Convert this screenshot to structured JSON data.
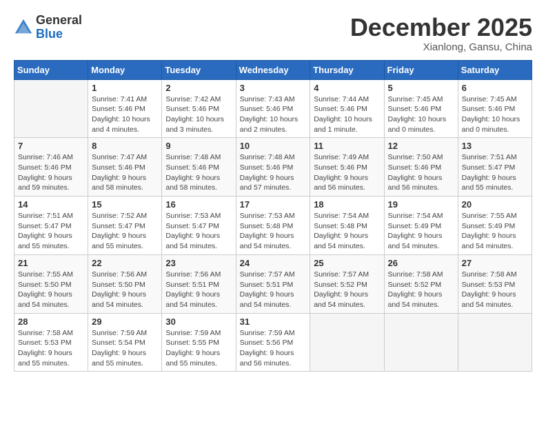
{
  "header": {
    "logo_line1": "General",
    "logo_line2": "Blue",
    "month": "December 2025",
    "location": "Xianlong, Gansu, China"
  },
  "weekdays": [
    "Sunday",
    "Monday",
    "Tuesday",
    "Wednesday",
    "Thursday",
    "Friday",
    "Saturday"
  ],
  "weeks": [
    [
      {
        "day": "",
        "info": ""
      },
      {
        "day": "1",
        "info": "Sunrise: 7:41 AM\nSunset: 5:46 PM\nDaylight: 10 hours\nand 4 minutes."
      },
      {
        "day": "2",
        "info": "Sunrise: 7:42 AM\nSunset: 5:46 PM\nDaylight: 10 hours\nand 3 minutes."
      },
      {
        "day": "3",
        "info": "Sunrise: 7:43 AM\nSunset: 5:46 PM\nDaylight: 10 hours\nand 2 minutes."
      },
      {
        "day": "4",
        "info": "Sunrise: 7:44 AM\nSunset: 5:46 PM\nDaylight: 10 hours\nand 1 minute."
      },
      {
        "day": "5",
        "info": "Sunrise: 7:45 AM\nSunset: 5:46 PM\nDaylight: 10 hours\nand 0 minutes."
      },
      {
        "day": "6",
        "info": "Sunrise: 7:45 AM\nSunset: 5:46 PM\nDaylight: 10 hours\nand 0 minutes."
      }
    ],
    [
      {
        "day": "7",
        "info": "Sunrise: 7:46 AM\nSunset: 5:46 PM\nDaylight: 9 hours\nand 59 minutes."
      },
      {
        "day": "8",
        "info": "Sunrise: 7:47 AM\nSunset: 5:46 PM\nDaylight: 9 hours\nand 58 minutes."
      },
      {
        "day": "9",
        "info": "Sunrise: 7:48 AM\nSunset: 5:46 PM\nDaylight: 9 hours\nand 58 minutes."
      },
      {
        "day": "10",
        "info": "Sunrise: 7:48 AM\nSunset: 5:46 PM\nDaylight: 9 hours\nand 57 minutes."
      },
      {
        "day": "11",
        "info": "Sunrise: 7:49 AM\nSunset: 5:46 PM\nDaylight: 9 hours\nand 56 minutes."
      },
      {
        "day": "12",
        "info": "Sunrise: 7:50 AM\nSunset: 5:46 PM\nDaylight: 9 hours\nand 56 minutes."
      },
      {
        "day": "13",
        "info": "Sunrise: 7:51 AM\nSunset: 5:47 PM\nDaylight: 9 hours\nand 55 minutes."
      }
    ],
    [
      {
        "day": "14",
        "info": "Sunrise: 7:51 AM\nSunset: 5:47 PM\nDaylight: 9 hours\nand 55 minutes."
      },
      {
        "day": "15",
        "info": "Sunrise: 7:52 AM\nSunset: 5:47 PM\nDaylight: 9 hours\nand 55 minutes."
      },
      {
        "day": "16",
        "info": "Sunrise: 7:53 AM\nSunset: 5:47 PM\nDaylight: 9 hours\nand 54 minutes."
      },
      {
        "day": "17",
        "info": "Sunrise: 7:53 AM\nSunset: 5:48 PM\nDaylight: 9 hours\nand 54 minutes."
      },
      {
        "day": "18",
        "info": "Sunrise: 7:54 AM\nSunset: 5:48 PM\nDaylight: 9 hours\nand 54 minutes."
      },
      {
        "day": "19",
        "info": "Sunrise: 7:54 AM\nSunset: 5:49 PM\nDaylight: 9 hours\nand 54 minutes."
      },
      {
        "day": "20",
        "info": "Sunrise: 7:55 AM\nSunset: 5:49 PM\nDaylight: 9 hours\nand 54 minutes."
      }
    ],
    [
      {
        "day": "21",
        "info": "Sunrise: 7:55 AM\nSunset: 5:50 PM\nDaylight: 9 hours\nand 54 minutes."
      },
      {
        "day": "22",
        "info": "Sunrise: 7:56 AM\nSunset: 5:50 PM\nDaylight: 9 hours\nand 54 minutes."
      },
      {
        "day": "23",
        "info": "Sunrise: 7:56 AM\nSunset: 5:51 PM\nDaylight: 9 hours\nand 54 minutes."
      },
      {
        "day": "24",
        "info": "Sunrise: 7:57 AM\nSunset: 5:51 PM\nDaylight: 9 hours\nand 54 minutes."
      },
      {
        "day": "25",
        "info": "Sunrise: 7:57 AM\nSunset: 5:52 PM\nDaylight: 9 hours\nand 54 minutes."
      },
      {
        "day": "26",
        "info": "Sunrise: 7:58 AM\nSunset: 5:52 PM\nDaylight: 9 hours\nand 54 minutes."
      },
      {
        "day": "27",
        "info": "Sunrise: 7:58 AM\nSunset: 5:53 PM\nDaylight: 9 hours\nand 54 minutes."
      }
    ],
    [
      {
        "day": "28",
        "info": "Sunrise: 7:58 AM\nSunset: 5:53 PM\nDaylight: 9 hours\nand 55 minutes."
      },
      {
        "day": "29",
        "info": "Sunrise: 7:59 AM\nSunset: 5:54 PM\nDaylight: 9 hours\nand 55 minutes."
      },
      {
        "day": "30",
        "info": "Sunrise: 7:59 AM\nSunset: 5:55 PM\nDaylight: 9 hours\nand 55 minutes."
      },
      {
        "day": "31",
        "info": "Sunrise: 7:59 AM\nSunset: 5:56 PM\nDaylight: 9 hours\nand 56 minutes."
      },
      {
        "day": "",
        "info": ""
      },
      {
        "day": "",
        "info": ""
      },
      {
        "day": "",
        "info": ""
      }
    ]
  ]
}
